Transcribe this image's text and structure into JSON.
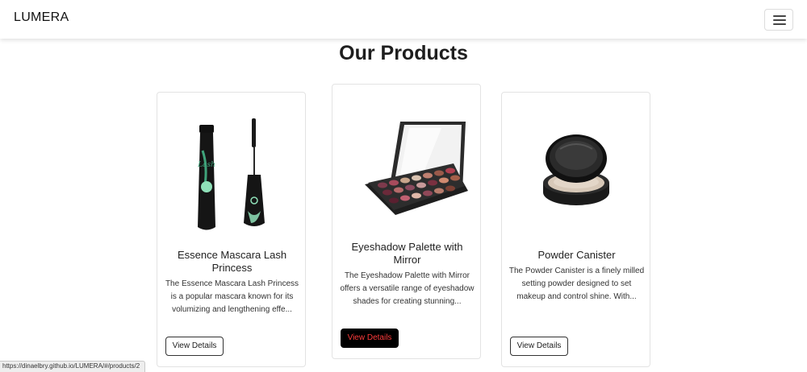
{
  "navbar": {
    "brand": "LUMERA",
    "menu_icon": "hamburger-menu-icon"
  },
  "main": {
    "title": "Our Products",
    "products": [
      {
        "title": "Essence Mascara Lash Princess",
        "description": "The Essence Mascara Lash Princess is a popular mascara known for its volumizing and lengthening effe...",
        "button_label": "View Details",
        "image_icon": "mascara-product-image"
      },
      {
        "title": "Eyeshadow Palette with Mirror",
        "description": "The Eyeshadow Palette with Mirror offers a versatile range of eyeshadow shades for creating stunning...",
        "button_label": "View Details",
        "image_icon": "eyeshadow-palette-product-image"
      },
      {
        "title": "Powder Canister",
        "description": "The Powder Canister is a finely milled setting powder designed to set makeup and control shine. With...",
        "button_label": "View Details",
        "image_icon": "powder-canister-product-image"
      }
    ]
  },
  "status_bar": {
    "url": "https://dinaelbry.github.io/LUMERA/#/products/2"
  },
  "colors": {
    "hover_button_bg": "#000000",
    "hover_button_text": "#ff3b3b"
  }
}
